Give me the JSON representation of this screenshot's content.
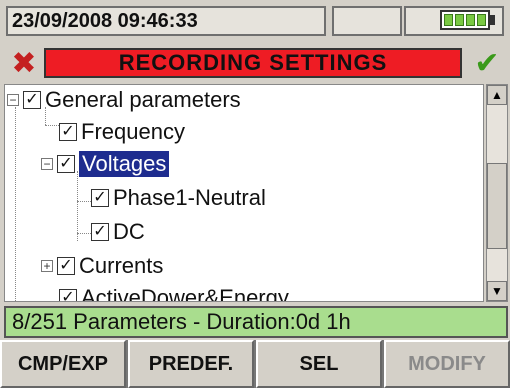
{
  "status_bar": {
    "datetime": "23/09/2008 09:46:33",
    "battery_icon": "battery-full-icon"
  },
  "title_bar": {
    "title": "RECORDING SETTINGS",
    "close_icon": "red-x-icon",
    "ok_icon": "green-check-icon"
  },
  "tree": {
    "items": [
      {
        "label": "General parameters",
        "expanded": true,
        "checked": true
      },
      {
        "label": "Frequency",
        "checked": true
      },
      {
        "label": "Voltages",
        "expanded": true,
        "checked": true,
        "selected": true
      },
      {
        "label": "Phase1-Neutral",
        "checked": true
      },
      {
        "label": "DC",
        "checked": true
      },
      {
        "label": "Currents",
        "expanded": false,
        "checked": true
      },
      {
        "label": "ActiveDower&Energy",
        "checked": true
      }
    ]
  },
  "info_bar": {
    "text": "8/251 Parameters - Duration:0d 1h"
  },
  "softkeys": [
    {
      "label": "CMP/EXP",
      "enabled": true
    },
    {
      "label": "PREDEF.",
      "enabled": true
    },
    {
      "label": "SEL",
      "enabled": true
    },
    {
      "label": "MODIFY",
      "enabled": false
    }
  ],
  "colors": {
    "title_red": "#ee1c24",
    "info_green": "#a9dd8e",
    "selection_blue": "#1e2c8f"
  }
}
